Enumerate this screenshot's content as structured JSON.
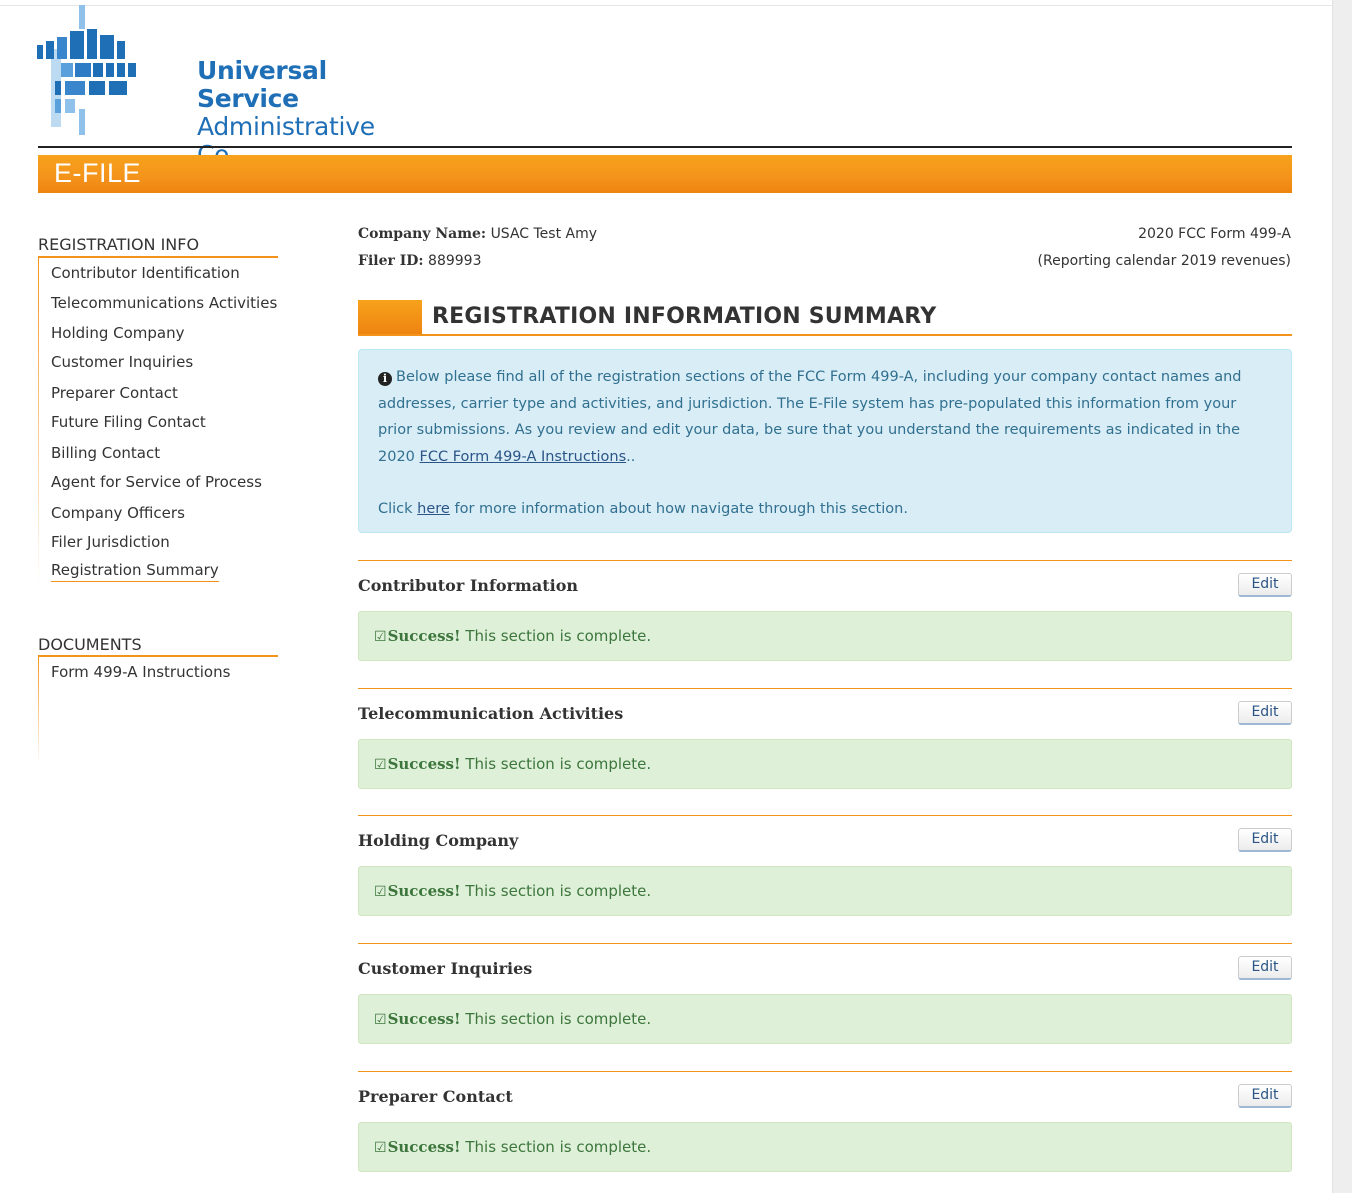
{
  "brand": {
    "line1": "Universal Service",
    "line2": "Administrative Co.",
    "colors": {
      "logo_blue": "#1f6fb7",
      "logo_light": "#8fc1ea",
      "accent_orange": "#f4931b"
    }
  },
  "banner": {
    "label": "E-FILE"
  },
  "sidebar": {
    "registration_heading": "REGISTRATION INFO",
    "registration_items": [
      "Contributor Identification",
      "Telecommunications Activities",
      "Holding Company",
      "Customer Inquiries",
      "Preparer Contact",
      "Future Filing Contact",
      "Billing Contact",
      "Agent for Service of Process",
      "Company Officers",
      "Filer Jurisdiction",
      "Registration Summary"
    ],
    "active_item": "Registration Summary",
    "documents_heading": "DOCUMENTS",
    "documents_items": [
      "Form 499-A Instructions"
    ]
  },
  "meta": {
    "company_label": "Company Name:",
    "company_value": "USAC Test Amy",
    "filer_label": "Filer ID:",
    "filer_value": "889993",
    "form_title": "2020 FCC Form 499-A",
    "form_subtitle": "(Reporting calendar 2019 revenues)"
  },
  "summary": {
    "title": "REGISTRATION INFORMATION SUMMARY",
    "info_icon": "info-circle-icon",
    "info_text": "Below please find all of the registration sections of the FCC Form 499-A, including your company contact names and addresses, carrier type and activities, and jurisdiction. The E-File system has pre-populated this information from your prior submissions. As you review and edit your data, be sure that you understand the requirements as indicated in the 2020",
    "info_link": "FCC Form 499-A Instructions",
    "info_after_link": "..",
    "click_pre": "Click",
    "click_link": "here",
    "click_post": "for more information about how navigate through this section."
  },
  "sections": [
    {
      "name": "Contributor Information",
      "edit": "Edit",
      "status_strong": "Success!",
      "status_text": "This section is complete."
    },
    {
      "name": "Telecommunication Activities",
      "edit": "Edit",
      "status_strong": "Success!",
      "status_text": "This section is complete."
    },
    {
      "name": "Holding Company",
      "edit": "Edit",
      "status_strong": "Success!",
      "status_text": "This section is complete."
    },
    {
      "name": "Customer Inquiries",
      "edit": "Edit",
      "status_strong": "Success!",
      "status_text": "This section is complete."
    },
    {
      "name": "Preparer Contact",
      "edit": "Edit",
      "status_strong": "Success!",
      "status_text": "This section is complete."
    }
  ]
}
